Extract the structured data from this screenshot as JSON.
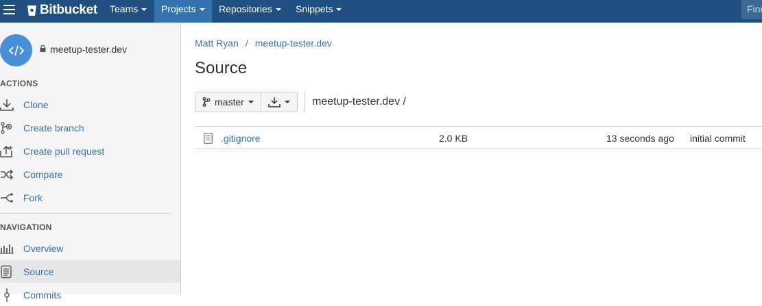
{
  "topbar": {
    "brand": "Bitbucket",
    "nav": [
      {
        "label": "Teams"
      },
      {
        "label": "Projects",
        "active": true
      },
      {
        "label": "Repositories"
      },
      {
        "label": "Snippets"
      }
    ],
    "find_placeholder": "Find",
    "bg_color": "#205081"
  },
  "sidebar": {
    "repo_name": "meetup-tester.dev",
    "actions_heading": "ACTIONS",
    "actions": [
      {
        "label": "Clone",
        "icon": "download-icon"
      },
      {
        "label": "Create branch",
        "icon": "branch-icon"
      },
      {
        "label": "Create pull request",
        "icon": "pull-request-icon"
      },
      {
        "label": "Compare",
        "icon": "compare-icon"
      },
      {
        "label": "Fork",
        "icon": "fork-icon"
      }
    ],
    "navigation_heading": "NAVIGATION",
    "navigation": [
      {
        "label": "Overview",
        "icon": "chart-icon"
      },
      {
        "label": "Source",
        "icon": "file-icon",
        "selected": true
      },
      {
        "label": "Commits",
        "icon": "commit-icon"
      }
    ]
  },
  "main": {
    "breadcrumb": {
      "owner": "Matt Ryan",
      "separator": "/",
      "repo": "meetup-tester.dev"
    },
    "title": "Source",
    "branch": "master",
    "path": "meetup-tester.dev /",
    "files": [
      {
        "name": ".gitignore",
        "size": "2.0 KB",
        "time": "13 seconds ago",
        "message": "initial commit"
      }
    ]
  }
}
